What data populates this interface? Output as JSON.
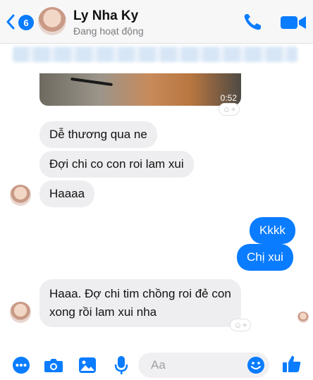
{
  "header": {
    "back_badge": "6",
    "contact_name": "Ly Nha Ky",
    "status": "Đang hoạt động"
  },
  "video": {
    "duration": "0:52"
  },
  "messages": [
    {
      "from": "them",
      "text": "Dễ thương qua ne"
    },
    {
      "from": "them",
      "text": "Đợi chi co con roi lam xui"
    },
    {
      "from": "them",
      "text": "Haaaa"
    },
    {
      "from": "me",
      "text": "Kkkk"
    },
    {
      "from": "me",
      "text": "Chị xui"
    },
    {
      "from": "them",
      "lines": [
        "Haaa. Đợ chi tim chồng roi đẻ con",
        "xong rồi lam xui nha"
      ]
    }
  ],
  "composer": {
    "placeholder": "Aa"
  },
  "colors": {
    "accent": "#0a7cff",
    "received_bubble": "#eeeef0"
  },
  "icons": [
    "back-icon",
    "phone-icon",
    "video-call-icon",
    "more-icon",
    "camera-icon",
    "gallery-icon",
    "microphone-icon",
    "emoji-icon",
    "like-icon"
  ]
}
